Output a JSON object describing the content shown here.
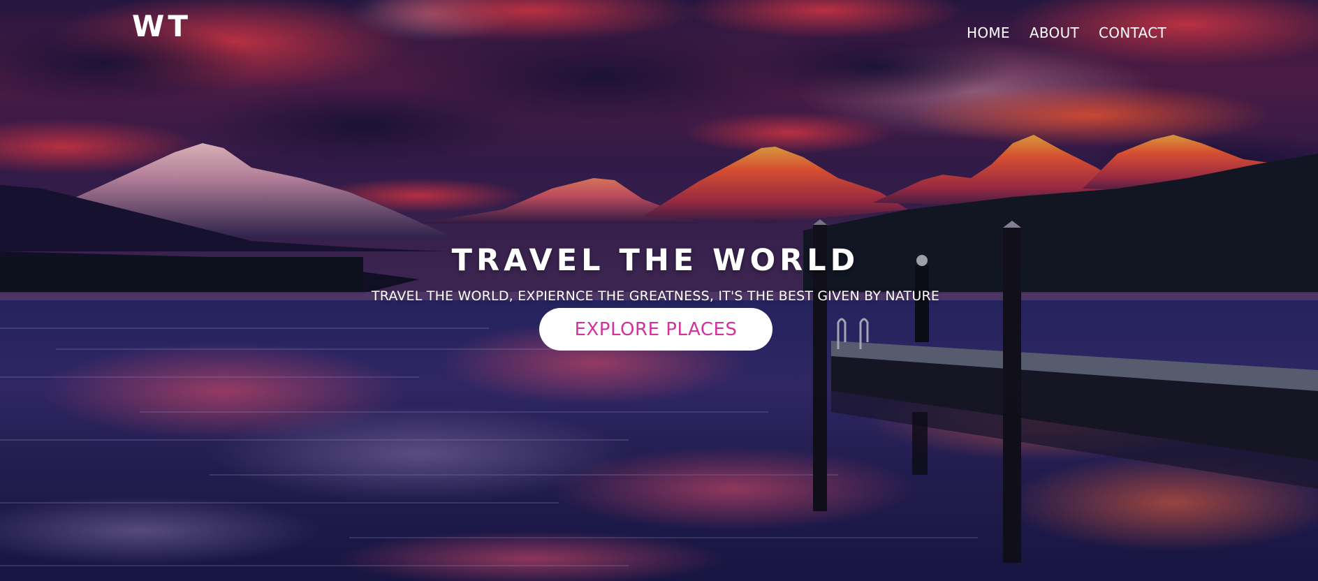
{
  "header": {
    "logo": "WT",
    "nav": [
      {
        "label": "HOME"
      },
      {
        "label": "ABOUT"
      },
      {
        "label": "CONTACT"
      }
    ]
  },
  "hero": {
    "title": "TRAVEL THE WORLD",
    "subtitle": "TRAVEL THE WORLD, EXPIERNCE THE GREATNESS, IT'S THE BEST GIVEN BY NATURE",
    "cta_label": "EXPLORE PLACES",
    "background_image": "mountain-lake-sunset-with-pier",
    "colors": {
      "cta_text": "#d2339b",
      "cta_background": "#ffffff",
      "text": "#ffffff"
    }
  }
}
